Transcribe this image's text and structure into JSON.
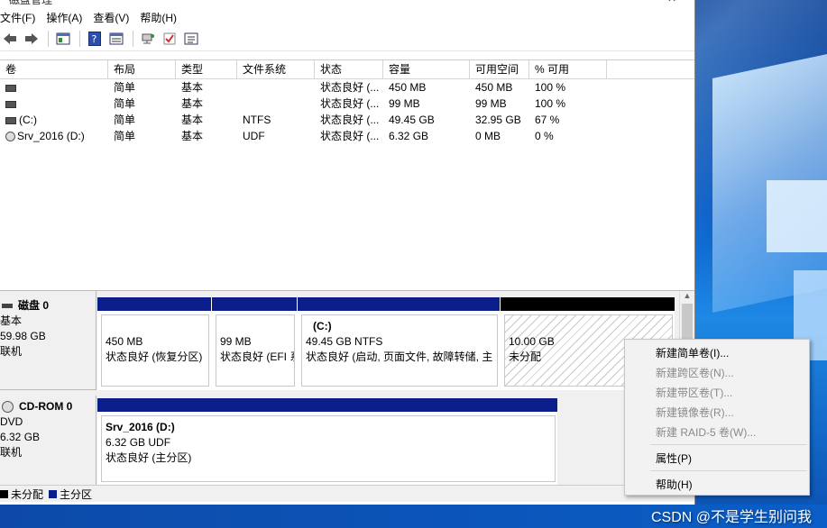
{
  "window": {
    "title": "磁盘管理"
  },
  "menu": [
    "文件(F)",
    "操作(A)",
    "查看(V)",
    "帮助(H)"
  ],
  "toolbar_icons": [
    "back-arrow-icon",
    "forward-arrow-icon",
    "properties-icon",
    "help-icon",
    "console-tree-icon",
    "connect-icon",
    "checkmark-icon",
    "settings-list-icon"
  ],
  "table": {
    "headers": [
      "卷",
      "布局",
      "类型",
      "文件系统",
      "状态",
      "容量",
      "可用空间",
      "% 可用"
    ],
    "rows": [
      [
        "",
        "简单",
        "基本",
        "",
        "状态良好 (...",
        "450 MB",
        "450 MB",
        "100 %"
      ],
      [
        "",
        "简单",
        "基本",
        "",
        "状态良好 (...",
        "99 MB",
        "99 MB",
        "100 %"
      ],
      [
        "(C:)",
        "简单",
        "基本",
        "NTFS",
        "状态良好 (...",
        "49.45 GB",
        "32.95 GB",
        "67 %"
      ],
      [
        "Srv_2016 (D:)",
        "简单",
        "基本",
        "UDF",
        "状态良好 (...",
        "6.32 GB",
        "0 MB",
        "0 %"
      ]
    ]
  },
  "disk0": {
    "name": "磁盘 0",
    "type": "基本",
    "size": "59.98 GB",
    "status": "联机",
    "partitions": [
      {
        "label": "",
        "size": "450 MB",
        "status": "状态良好 (恢复分区)"
      },
      {
        "label": "",
        "size": "99 MB",
        "status": "状态良好 (EFI 系"
      },
      {
        "label": "(C:)",
        "size": "49.45 GB NTFS",
        "status": "状态良好 (启动, 页面文件, 故障转储, 主"
      },
      {
        "label": "",
        "size": "10.00 GB",
        "status": "未分配"
      }
    ]
  },
  "cdrom0": {
    "name": "CD-ROM 0",
    "type": "DVD",
    "size": "6.32 GB",
    "status": "联机",
    "partition": {
      "label": "Srv_2016  (D:)",
      "size": "6.32 GB UDF",
      "status": "状态良好 (主分区)"
    }
  },
  "legend": {
    "unallocated": "未分配",
    "primary": "主分区",
    "unallocated_color": "#000000",
    "primary_color": "#0b1e8a"
  },
  "context_menu": {
    "new_simple": "新建简单卷(I)...",
    "new_spanned": "新建跨区卷(N)...",
    "new_striped": "新建带区卷(T)...",
    "new_mirrored": "新建镜像卷(R)...",
    "new_raid5": "新建 RAID-5 卷(W)...",
    "properties": "属性(P)",
    "help": "帮助(H)"
  },
  "watermark": "CSDN @不是学生别问我"
}
